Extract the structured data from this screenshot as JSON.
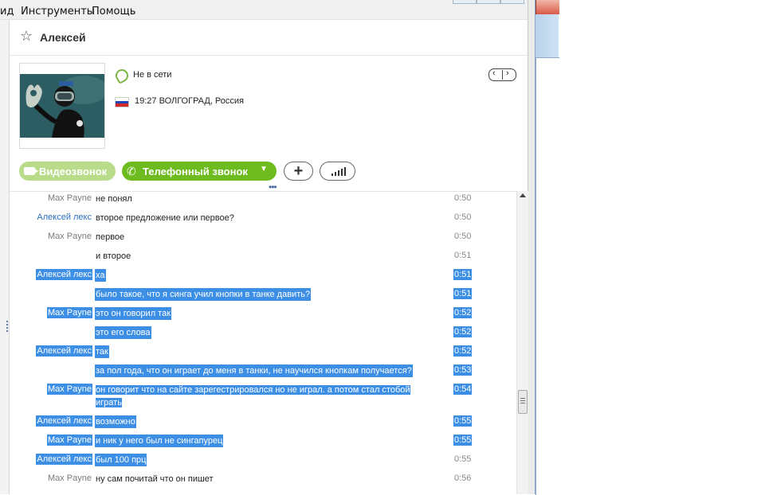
{
  "menu": {
    "items": [
      "ид",
      "Инструменты",
      "Помощь"
    ]
  },
  "contact": {
    "name": "Алексей",
    "status": "Не в сети",
    "local_time": "19:27",
    "location": "ВОЛГОГРАД, Россия"
  },
  "calls": {
    "video_label": "Видеозвонок",
    "phone_label": "Телефонный звонок"
  },
  "icons": {
    "favorite": "star-icon",
    "status": "offline-status-icon",
    "flag": "russia-flag-icon",
    "add": "plus-icon",
    "quality": "signal-bars-icon"
  },
  "colors": {
    "call_green": "#6dbb1f",
    "video_disabled": "#b8dc8a",
    "selection": "#3d8fe6",
    "contact_blue": "#2a6fc1"
  },
  "chat": {
    "messages": [
      {
        "sender": "Max Payne",
        "text": "не понял",
        "time": "0:50"
      },
      {
        "sender": "Алексей лекс",
        "text": "второе предложение или первое?",
        "time": "0:50"
      },
      {
        "sender": "Max Payne",
        "text": "первое",
        "time": "0:50"
      },
      {
        "sender": "",
        "text": "и второе",
        "time": "0:51"
      },
      {
        "sender": "Алексей лекс",
        "text": "ха",
        "time": "0:51"
      },
      {
        "sender": "",
        "text": "было такое, что я синга учил кнопки в танке давить?",
        "time": "0:51"
      },
      {
        "sender": "Max Payne",
        "text": "это он говорил так",
        "time": "0:52"
      },
      {
        "sender": "",
        "text": "это его слова",
        "time": "0:52"
      },
      {
        "sender": "Алексей лекс",
        "text": "так",
        "time": "0:52"
      },
      {
        "sender": "",
        "text": "за пол года, что он играет до меня в танки, не научился кнопкам получается?",
        "time": "0:53"
      },
      {
        "sender": "Max Payne",
        "text": "он говорит что на сайте зарегестрировался но не играл. а потом стал стобой",
        "text2": "играть",
        "time": "0:54"
      },
      {
        "sender": "Алексей лекс",
        "text": "возможно",
        "time": "0:55"
      },
      {
        "sender": "Max Payne",
        "text": "и ник у него был не сингапурец",
        "time": "0:55"
      },
      {
        "sender": "Алексей лекс",
        "text": "был 100 прц",
        "time": "0:55"
      },
      {
        "sender": "Max Payne",
        "text": "ну сам почитай что он пишет",
        "time": "0:56"
      },
      {
        "sender": "",
        "text": "",
        "time": ""
      }
    ]
  }
}
